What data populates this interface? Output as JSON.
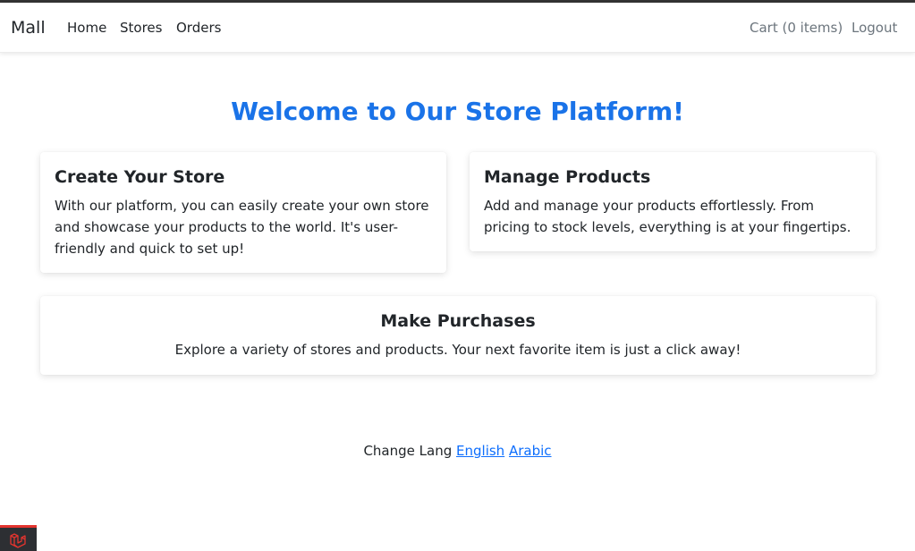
{
  "navbar": {
    "brand": "Mall",
    "links": [
      "Home",
      "Stores",
      "Orders"
    ],
    "cart_label": "Cart (0 items)",
    "logout_label": "Logout"
  },
  "main": {
    "title": "Welcome to Our Store Platform!",
    "cards": [
      {
        "title": "Create Your Store",
        "text": "With our platform, you can easily create your own store and showcase your products to the world. It's user-friendly and quick to set up!"
      },
      {
        "title": "Manage Products",
        "text": "Add and manage your products effortlessly. From pricing to stock levels, everything is at your fingertips."
      },
      {
        "title": "Make Purchases",
        "text": "Explore a variety of stores and products. Your next favorite item is just a click away!"
      }
    ]
  },
  "footer": {
    "change_lang_label": "Change Lang",
    "lang_english": "English",
    "lang_arabic": "Arabic"
  },
  "debugbar": {
    "icon": "laravel-logo-icon"
  },
  "colors": {
    "accent": "#1a73e8",
    "link": "#0d6efd",
    "debug_red": "#e3342f"
  }
}
